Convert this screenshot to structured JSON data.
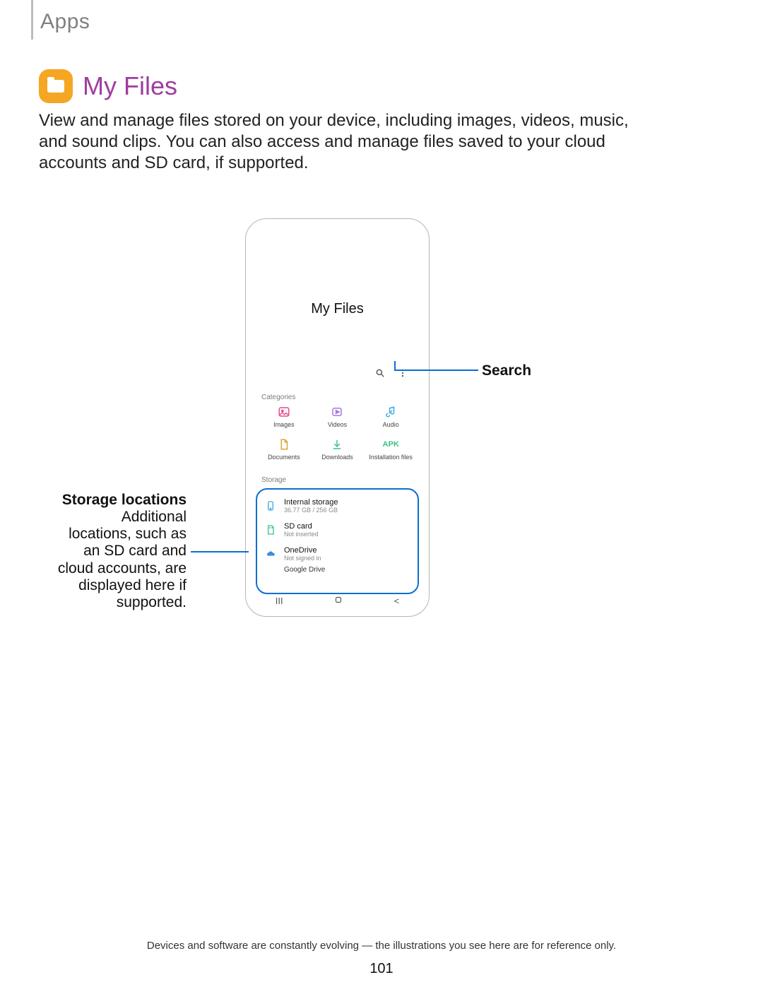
{
  "header": {
    "section": "Apps"
  },
  "title": "My Files",
  "description": "View and manage files stored on your device, including images, videos, music, and sound clips. You can also access and manage files saved to your cloud accounts and SD card, if supported.",
  "phone": {
    "screen_title": "My Files",
    "categories_label": "Categories",
    "categories": [
      {
        "name": "Images"
      },
      {
        "name": "Videos"
      },
      {
        "name": "Audio"
      },
      {
        "name": "Documents"
      },
      {
        "name": "Downloads"
      },
      {
        "name": "Installation files",
        "apk": "APK"
      }
    ],
    "storage_label": "Storage",
    "storage_items": [
      {
        "name": "Internal storage",
        "sub": "36.77 GB / 256 GB"
      },
      {
        "name": "SD card",
        "sub": "Not inserted"
      },
      {
        "name": "OneDrive",
        "sub": "Not signed in"
      }
    ],
    "storage_extra": "Google Drive"
  },
  "callouts": {
    "search": "Search",
    "storage_title": "Storage locations",
    "storage_body": "Additional locations, such as an SD card and cloud accounts, are displayed here if supported."
  },
  "footer": {
    "note": "Devices and software are constantly evolving — the illustrations you see here are for reference only.",
    "page": "101"
  }
}
